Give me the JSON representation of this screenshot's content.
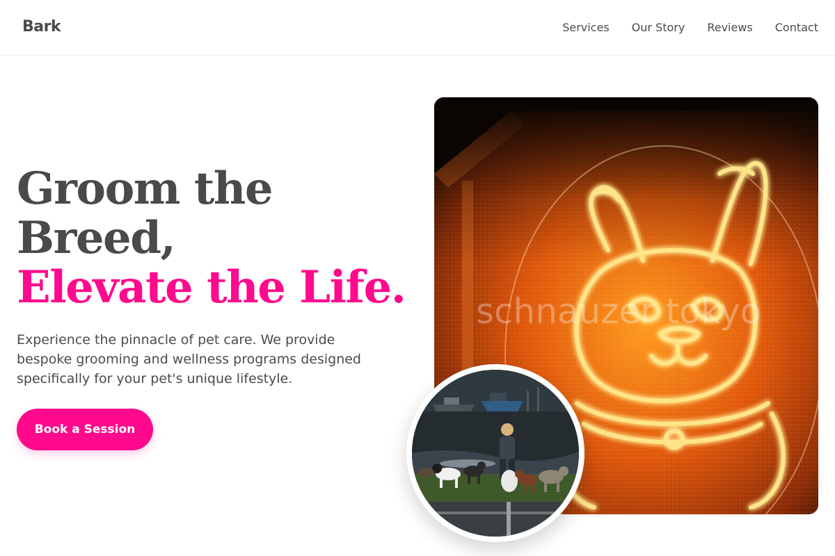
{
  "header": {
    "brand": "Bark",
    "nav": [
      "Services",
      "Our Story",
      "Reviews",
      "Contact"
    ]
  },
  "hero": {
    "headline_line1": "Groom the",
    "headline_line2": "Breed,",
    "headline_accent": "Elevate the Life.",
    "subtext": "Experience the pinnacle of pet care. We provide bespoke grooming and wellness programs designed specifically for your pet's unique lifestyle.",
    "cta_label": "Book a Session"
  },
  "images": {
    "main_watermark": "schnauzer tokyo"
  },
  "colors": {
    "accent": "#ff0a8c",
    "text": "#4a4a4a"
  }
}
